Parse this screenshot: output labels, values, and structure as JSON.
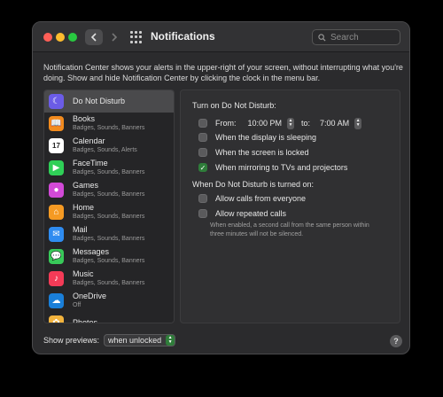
{
  "window": {
    "title": "Notifications",
    "search_placeholder": "Search"
  },
  "description": "Notification Center shows your alerts in the upper-right of your screen, without interrupting what you're doing. Show and hide Notification Center by clicking the clock in the menu bar.",
  "sidebar": {
    "items": [
      {
        "name": "Do Not Disturb",
        "sub": "",
        "icon": "moon-icon",
        "color": "#6b5ce7",
        "selected": true
      },
      {
        "name": "Books",
        "sub": "Badges, Sounds, Banners",
        "icon": "book-icon",
        "color": "#f28b1e"
      },
      {
        "name": "Calendar",
        "sub": "Badges, Sounds, Alerts",
        "icon": "calendar-icon",
        "color": "#ffffff"
      },
      {
        "name": "FaceTime",
        "sub": "Badges, Sounds, Banners",
        "icon": "video-icon",
        "color": "#2fcf57"
      },
      {
        "name": "Games",
        "sub": "Badges, Sounds, Banners",
        "icon": "games-icon",
        "color": "#d24ad8"
      },
      {
        "name": "Home",
        "sub": "Badges, Sounds, Banners",
        "icon": "house-icon",
        "color": "#f59a23"
      },
      {
        "name": "Mail",
        "sub": "Badges, Sounds, Banners",
        "icon": "envelope-icon",
        "color": "#2f8cf0"
      },
      {
        "name": "Messages",
        "sub": "Badges, Sounds, Banners",
        "icon": "speech-bubble-icon",
        "color": "#38c959"
      },
      {
        "name": "Music",
        "sub": "Badges, Sounds, Banners",
        "icon": "music-note-icon",
        "color": "#f43b57"
      },
      {
        "name": "OneDrive",
        "sub": "Off",
        "icon": "cloud-icon",
        "color": "#1a7fd9"
      },
      {
        "name": "Photos",
        "sub": "",
        "icon": "photos-icon",
        "color": "#f2b33d"
      }
    ]
  },
  "dnd": {
    "heading": "Turn on Do Not Disturb:",
    "from_label": "From:",
    "from_time": "10:00 PM",
    "to_label": "to:",
    "to_time": "7:00 AM",
    "options": [
      {
        "label": "When the display is sleeping",
        "checked": false
      },
      {
        "label": "When the screen is locked",
        "checked": false
      },
      {
        "label": "When mirroring to TVs and projectors",
        "checked": true
      }
    ],
    "when_on_heading": "When Do Not Disturb is turned on:",
    "allow_everyone": "Allow calls from everyone",
    "allow_repeated": "Allow repeated calls",
    "note": "When enabled, a second call from the same person within three minutes will not be silenced."
  },
  "footer": {
    "preview_label": "Show previews:",
    "preview_value": "when unlocked",
    "help": "?"
  },
  "colors": {
    "accent": "#2f7d3a",
    "selection": "#4a4a4c"
  }
}
